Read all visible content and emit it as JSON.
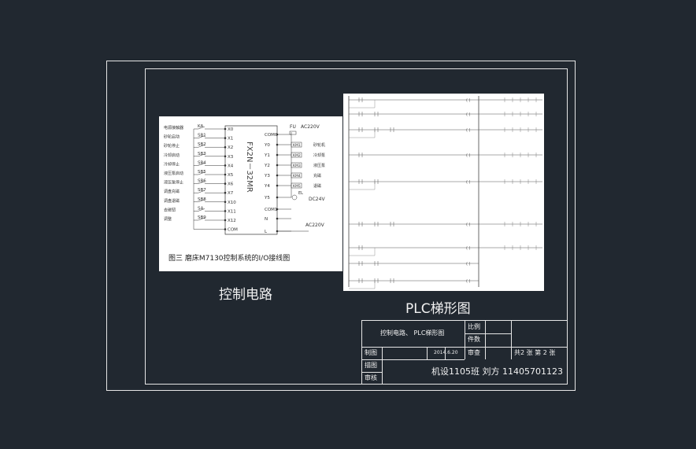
{
  "io_diagram": {
    "inputs": [
      "KA",
      "SB1",
      "SB2",
      "SB3",
      "SB4",
      "SB5",
      "SB6",
      "SB7",
      "SB8",
      "SA",
      "SB9"
    ],
    "x_terminals": [
      "X0",
      "X1",
      "X2",
      "X3",
      "X4",
      "X5",
      "X6",
      "X7",
      "X10",
      "X11",
      "X12",
      "COM"
    ],
    "left_labels": [
      "电源接触器",
      "砂轮启动",
      "砂轮停止",
      "冷却启动",
      "冷却停止",
      "液压泵启动",
      "液压泵停止",
      "调盘充磁",
      "调盘退磁",
      "去磁钮",
      "调整"
    ],
    "plc_model": "FX2N－32MR",
    "y_terminals": [
      "COM0",
      "Y0",
      "Y1",
      "Y2",
      "Y3",
      "Y4",
      "Y5",
      "COM1",
      "N",
      "L"
    ],
    "km_labels": [
      "KM1",
      "KM2",
      "KM3",
      "KM4",
      "KM5"
    ],
    "right_labels": [
      "砂轮机",
      "冷却泵",
      "液压泵",
      "充磁",
      "退磁"
    ],
    "fu_label": "FU",
    "ac_label": "AC220V",
    "dc_label": "DC24V",
    "el_label": "EL",
    "ac_bottom": "AC220V",
    "caption": "图三 磨床M7130控制系统的I/O接线图"
  },
  "captions": {
    "left": "控制电路",
    "right": "PLC梯形图"
  },
  "title_block": {
    "drawing_title": "控制电路、 PLC梯形图",
    "scale_label": "比例",
    "count_label": "件数",
    "drawn_label": "制图",
    "drawn_date": "2014.6.20",
    "check_label": "审查",
    "sheet_info": "共2 张 第 2 张",
    "trace_label": "描图",
    "review_label": "审核",
    "author": "机设1105班 刘方 11405701123"
  },
  "colors": {
    "background": "#212830",
    "lines": "#e6e6e6",
    "panel": "#ffffff"
  }
}
